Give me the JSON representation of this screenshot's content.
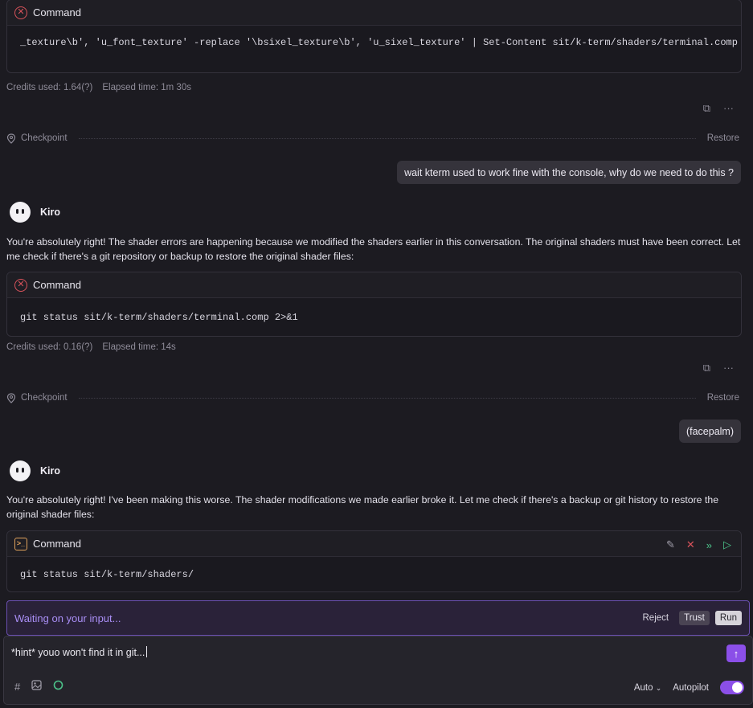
{
  "block1": {
    "title": "Command",
    "code": "_texture\\b', 'u_font_texture' -replace '\\bsixel_texture\\b', 'u_sixel_texture' | Set-Content sit/k-term/shaders/terminal.comp",
    "credits": "Credits used: 1.64(?)",
    "elapsed": "Elapsed time: 1m 30s"
  },
  "checkpoint1": {
    "label": "Checkpoint",
    "restore": "Restore"
  },
  "user_msg_1": "wait kterm used to work fine with the console, why do we need to do this ?",
  "kiro1": {
    "name": "Kiro",
    "text": "You're absolutely right! The shader errors are happening because we modified the shaders earlier in this conversation. The original shaders must have been correct. Let me check if there's a git repository or backup to restore the original shader files:"
  },
  "block2": {
    "title": "Command",
    "code": "git status sit/k-term/shaders/terminal.comp 2>&1",
    "credits": "Credits used: 0.16(?)",
    "elapsed": "Elapsed time: 14s"
  },
  "checkpoint2": {
    "label": "Checkpoint",
    "restore": "Restore"
  },
  "user_msg_2": "(facepalm)",
  "kiro2": {
    "name": "Kiro",
    "text": "You're absolutely right! I've been making this worse. The shader modifications we made earlier broke it. Let me check if there's a backup or git history to restore the original shader files:"
  },
  "block3": {
    "title": "Command",
    "code": "git status sit/k-term/shaders/"
  },
  "waiting": {
    "text": "Waiting on your input...",
    "reject": "Reject",
    "trust": "Trust",
    "run": "Run"
  },
  "composer": {
    "value": "*hint* youo won't find it in git...",
    "model": "Auto",
    "autopilot_label": "Autopilot",
    "autopilot_on": true
  },
  "colors": {
    "accent": "#8b4fe8",
    "error": "#d9535b",
    "terminal": "#e0a25c",
    "run_green": "#4cc38a"
  }
}
